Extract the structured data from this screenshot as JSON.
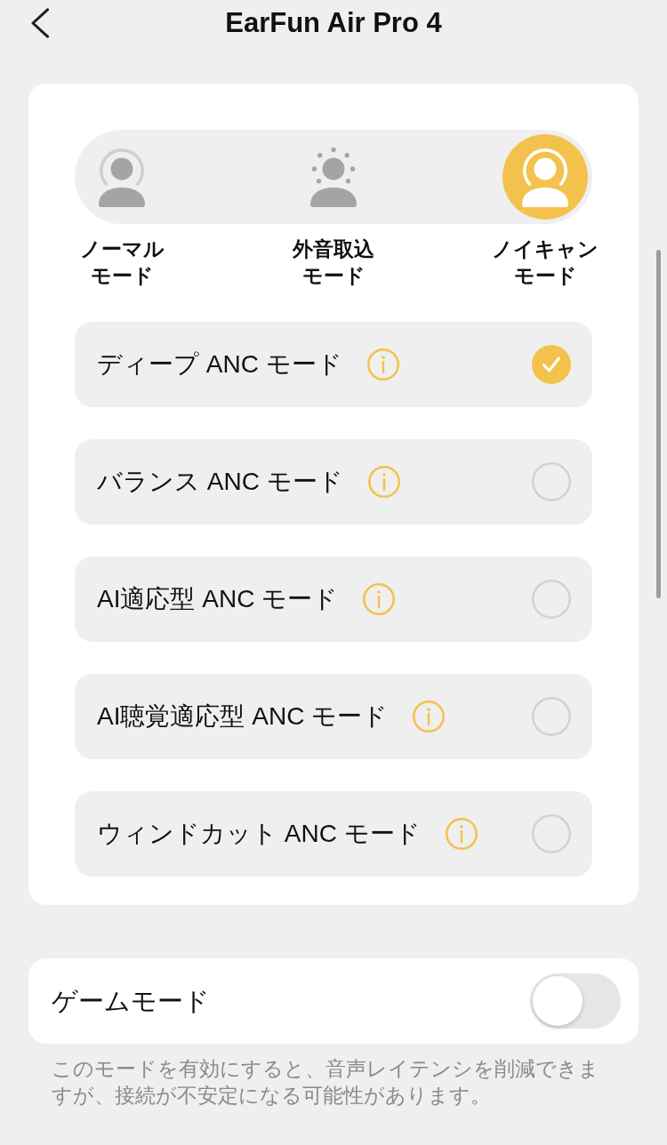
{
  "header": {
    "title": "EarFun Air Pro 4"
  },
  "mode_tabs": [
    {
      "kind": "normal",
      "label": "ノーマルモード",
      "selected": false
    },
    {
      "kind": "ambient",
      "label": "外音取込モード",
      "selected": false
    },
    {
      "kind": "anc",
      "label": "ノイキャンモード",
      "selected": true
    }
  ],
  "anc_options": [
    {
      "label": "ディープ ANC モード",
      "selected": true
    },
    {
      "label": "バランス ANC モード",
      "selected": false
    },
    {
      "label": "AI適応型 ANC モード",
      "selected": false
    },
    {
      "label": "AI聴覚適応型 ANC モード",
      "selected": false
    },
    {
      "label": "ウィンドカット ANC モード",
      "selected": false
    }
  ],
  "game_mode": {
    "label": "ゲームモード",
    "on": false
  },
  "game_mode_note": "このモードを有効にすると、音声レイテンシを削減できますが、接続が不安定になる可能性があります。"
}
